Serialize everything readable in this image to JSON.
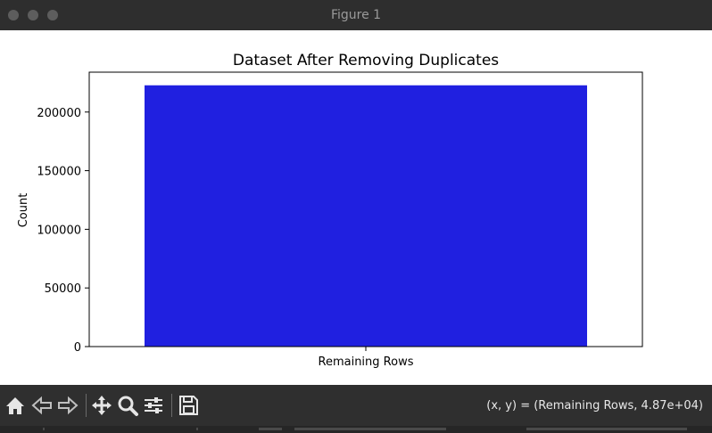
{
  "window": {
    "title": "Figure 1"
  },
  "chart_data": {
    "type": "bar",
    "title": "Dataset After Removing Duplicates",
    "xlabel": "",
    "ylabel": "Count",
    "categories": [
      "Remaining Rows"
    ],
    "values": [
      222800
    ],
    "ylim": [
      0,
      234000
    ],
    "yticks": [
      0,
      50000,
      100000,
      150000,
      200000
    ],
    "ytick_labels": [
      "0",
      "50000",
      "100000",
      "150000",
      "200000"
    ],
    "bar_color": "#2020e0",
    "grid": false
  },
  "toolbar": {
    "home": "home-icon",
    "back": "back-arrow-icon",
    "forward": "forward-arrow-icon",
    "pan": "pan-icon",
    "zoom": "zoom-icon",
    "configure": "configure-subplots-icon",
    "save": "save-icon",
    "coords_text": "(x, y) = (Remaining Rows, 4.87e+04)"
  },
  "colors": {
    "titlebar": "#2e2e2e",
    "toolbar": "#2f2f2f",
    "icon": "#e6e6e6"
  }
}
